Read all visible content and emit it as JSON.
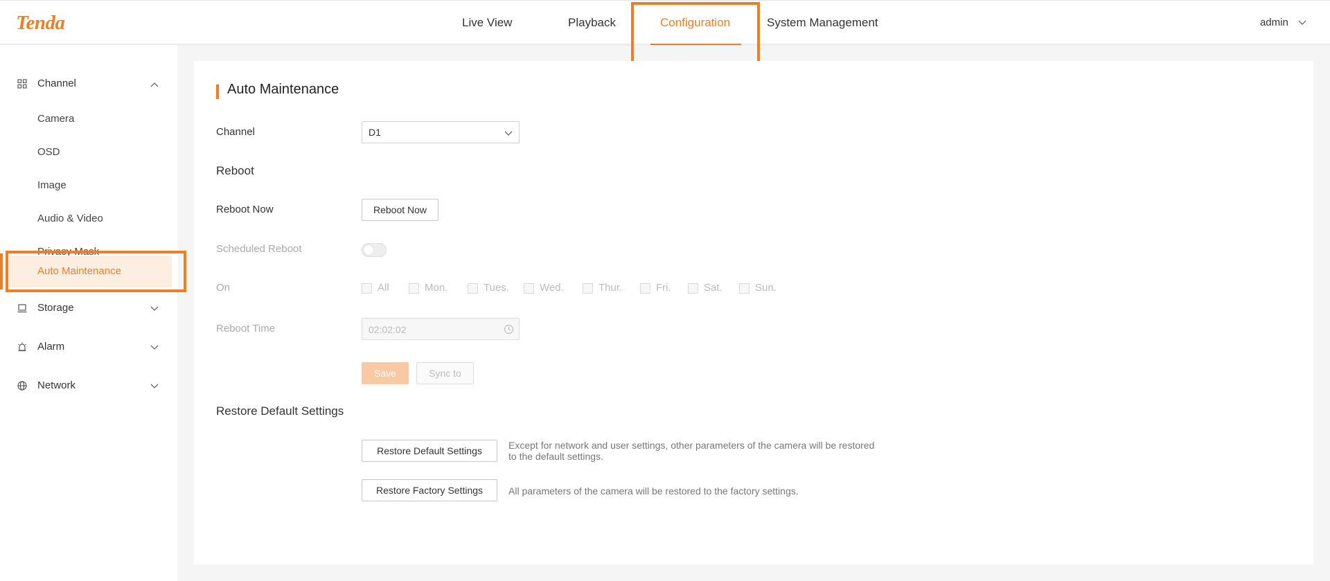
{
  "brand": {
    "logo_text": "Tenda",
    "accent_color": "#f07d23"
  },
  "topnav": {
    "items": [
      {
        "label": "Live View",
        "active": false
      },
      {
        "label": "Playback",
        "active": false
      },
      {
        "label": "Configuration",
        "active": true
      },
      {
        "label": "System Management",
        "active": false
      }
    ],
    "user": {
      "label": "admin",
      "icon": "chevron-down-icon"
    }
  },
  "sidebar": {
    "groups": [
      {
        "label": "Channel",
        "icon": "grid-icon",
        "expanded": true,
        "items": [
          {
            "label": "Camera",
            "active": false
          },
          {
            "label": "OSD",
            "active": false
          },
          {
            "label": "Image",
            "active": false
          },
          {
            "label": "Audio & Video",
            "active": false
          },
          {
            "label": "Privacy Mask",
            "active": false
          },
          {
            "label": "Auto Maintenance",
            "active": true
          }
        ]
      },
      {
        "label": "Storage",
        "icon": "storage-icon",
        "expanded": false
      },
      {
        "label": "Alarm",
        "icon": "alarm-icon",
        "expanded": false
      },
      {
        "label": "Network",
        "icon": "globe-icon",
        "expanded": false
      }
    ]
  },
  "main": {
    "title": "Auto Maintenance",
    "channel": {
      "label": "Channel",
      "value": "D1"
    },
    "reboot": {
      "section_title": "Reboot",
      "reboot_now_label": "Reboot Now",
      "reboot_now_button": "Reboot Now",
      "scheduled_label": "Scheduled Reboot",
      "scheduled_enabled": false,
      "on_label": "On",
      "days": [
        "All",
        "Mon.",
        "Tues.",
        "Wed.",
        "Thur.",
        "Fri.",
        "Sat.",
        "Sun."
      ],
      "time_label": "Reboot Time",
      "time_value": "02:02:02",
      "save_button": "Save",
      "sync_button": "Sync to"
    },
    "restore": {
      "section_title": "Restore Default Settings",
      "default_button": "Restore Default Settings",
      "default_desc": "Except for network and user settings, other parameters of the camera will be restored to the default settings.",
      "factory_button": "Restore Factory Settings",
      "factory_desc": "All parameters of the camera will be restored to the factory settings."
    }
  }
}
